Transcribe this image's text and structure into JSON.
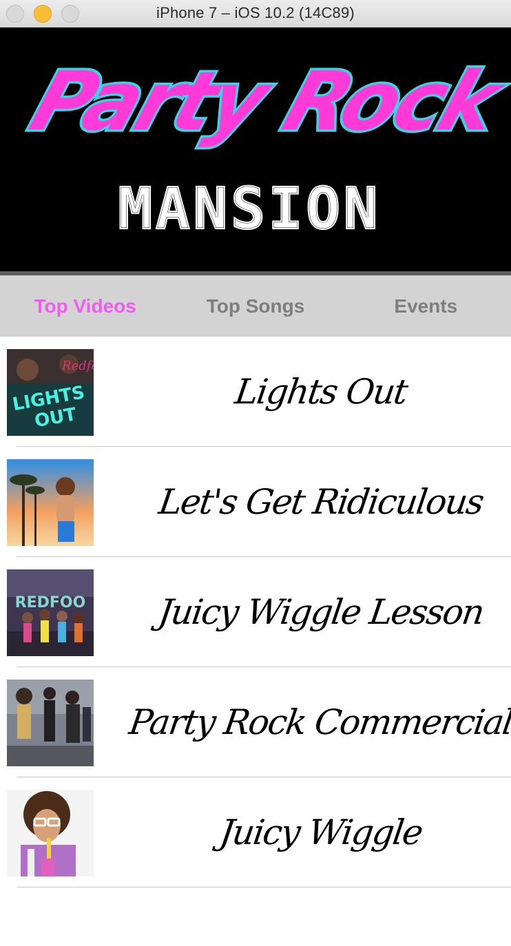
{
  "window": {
    "title": "iPhone 7 – iOS 10.2 (14C89)"
  },
  "banner": {
    "line1": "Party Rock",
    "line2": "MANSION",
    "colors": {
      "pink": "#ff3ad6",
      "cyan": "#34d6e6",
      "background": "#000000"
    }
  },
  "tabs": [
    {
      "label": "Top Videos",
      "active": true
    },
    {
      "label": "Top Songs",
      "active": false
    },
    {
      "label": "Events",
      "active": false
    }
  ],
  "accent_color": "#f05cf0",
  "videos": [
    {
      "title": "Lights Out",
      "thumb_text_1": "LIGHTS",
      "thumb_text_2": "OUT",
      "thumb_text_3": "Redfoo"
    },
    {
      "title": "Let's Get Ridiculous"
    },
    {
      "title": "Juicy Wiggle Lesson",
      "thumb_text_1": "REDFOO"
    },
    {
      "title": "Party Rock Commercial"
    },
    {
      "title": "Juicy Wiggle"
    }
  ]
}
